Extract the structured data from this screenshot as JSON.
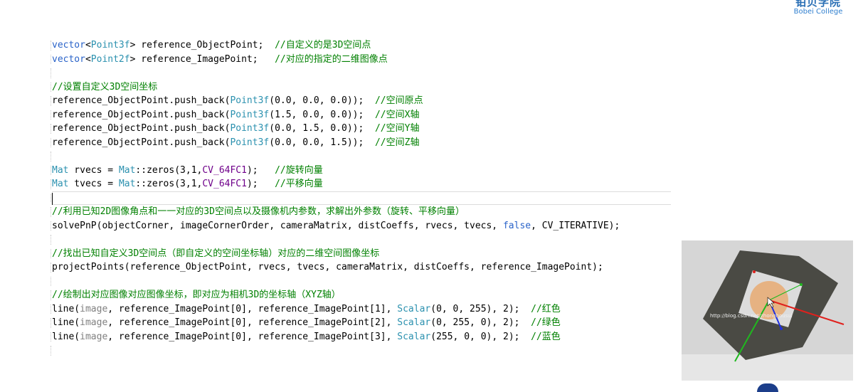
{
  "brand": {
    "name_cn": "铂贝学院",
    "name_en": "Bobei College"
  },
  "code_lines": [
    [
      {
        "t": "kw",
        "v": "vector"
      },
      {
        "t": "p",
        "v": "<"
      },
      {
        "t": "ty",
        "v": "Point3f"
      },
      {
        "t": "p",
        "v": "> reference_ObjectPoint;  "
      },
      {
        "t": "cm",
        "v": "//自定义的是3D空间点"
      }
    ],
    [
      {
        "t": "kw",
        "v": "vector"
      },
      {
        "t": "p",
        "v": "<"
      },
      {
        "t": "ty",
        "v": "Point2f"
      },
      {
        "t": "p",
        "v": "> reference_ImagePoint;   "
      },
      {
        "t": "cm",
        "v": "//对应的指定的二维图像点"
      }
    ],
    [],
    [
      {
        "t": "cm",
        "v": "//设置自定义3D空间坐标"
      }
    ],
    [
      {
        "t": "p",
        "v": "reference_ObjectPoint.push_back("
      },
      {
        "t": "ty",
        "v": "Point3f"
      },
      {
        "t": "p",
        "v": "(0.0, 0.0, 0.0));  "
      },
      {
        "t": "cm",
        "v": "//空间原点"
      }
    ],
    [
      {
        "t": "p",
        "v": "reference_ObjectPoint.push_back("
      },
      {
        "t": "ty",
        "v": "Point3f"
      },
      {
        "t": "p",
        "v": "(1.5, 0.0, 0.0));  "
      },
      {
        "t": "cm",
        "v": "//空间X轴"
      }
    ],
    [
      {
        "t": "p",
        "v": "reference_ObjectPoint.push_back("
      },
      {
        "t": "ty",
        "v": "Point3f"
      },
      {
        "t": "p",
        "v": "(0.0, 1.5, 0.0));  "
      },
      {
        "t": "cm",
        "v": "//空间Y轴"
      }
    ],
    [
      {
        "t": "p",
        "v": "reference_ObjectPoint.push_back("
      },
      {
        "t": "ty",
        "v": "Point3f"
      },
      {
        "t": "p",
        "v": "(0.0, 0.0, 1.5));  "
      },
      {
        "t": "cm",
        "v": "//空间Z轴"
      }
    ],
    [],
    [
      {
        "t": "ty",
        "v": "Mat"
      },
      {
        "t": "p",
        "v": " rvecs = "
      },
      {
        "t": "ty",
        "v": "Mat"
      },
      {
        "t": "p",
        "v": "::zeros(3,1,"
      },
      {
        "t": "mac",
        "v": "CV_64FC1"
      },
      {
        "t": "p",
        "v": ");   "
      },
      {
        "t": "cm",
        "v": "//旋转向量"
      }
    ],
    [
      {
        "t": "ty",
        "v": "Mat"
      },
      {
        "t": "p",
        "v": " tvecs = "
      },
      {
        "t": "ty",
        "v": "Mat"
      },
      {
        "t": "p",
        "v": "::zeros(3,1,"
      },
      {
        "t": "mac",
        "v": "CV_64FC1"
      },
      {
        "t": "p",
        "v": ");   "
      },
      {
        "t": "cm",
        "v": "//平移向量"
      }
    ],
    "CURSOR",
    [
      {
        "t": "cm",
        "v": "//利用已知2D图像角点和一一对应的3D空间点以及摄像机内参数，求解出外参数（旋转、平移向量）"
      }
    ],
    [
      {
        "t": "p",
        "v": "solvePnP(objectCorner, imageCornerOrder, cameraMatrix, distCoeffs, rvecs, tvecs, "
      },
      {
        "t": "kw",
        "v": "false"
      },
      {
        "t": "p",
        "v": ", CV_ITERATIVE);"
      }
    ],
    [],
    [
      {
        "t": "cm",
        "v": "//找出已知自定义3D空间点（即自定义的空间坐标轴）对应的二维空间图像坐标"
      }
    ],
    [
      {
        "t": "p",
        "v": "projectPoints(reference_ObjectPoint, rvecs, tvecs, cameraMatrix, distCoeffs, reference_ImagePoint);"
      }
    ],
    [],
    [
      {
        "t": "cm",
        "v": "//绘制出对应图像对应图像坐标，即对应为相机3D的坐标轴（XYZ轴）"
      }
    ],
    [
      {
        "t": "p",
        "v": "line("
      },
      {
        "t": "gray",
        "v": "image"
      },
      {
        "t": "p",
        "v": ", reference_ImagePoint[0], reference_ImagePoint[1], "
      },
      {
        "t": "ty",
        "v": "Scalar"
      },
      {
        "t": "p",
        "v": "(0, 0, 255), 2);  "
      },
      {
        "t": "cm",
        "v": "//红色"
      }
    ],
    [
      {
        "t": "p",
        "v": "line("
      },
      {
        "t": "gray",
        "v": "image"
      },
      {
        "t": "p",
        "v": ", reference_ImagePoint[0], reference_ImagePoint[2], "
      },
      {
        "t": "ty",
        "v": "Scalar"
      },
      {
        "t": "p",
        "v": "(0, 255, 0), 2);  "
      },
      {
        "t": "cm",
        "v": "//绿色"
      }
    ],
    [
      {
        "t": "p",
        "v": "line("
      },
      {
        "t": "gray",
        "v": "image"
      },
      {
        "t": "p",
        "v": ", reference_ImagePoint[0], reference_ImagePoint[3], "
      },
      {
        "t": "ty",
        "v": "Scalar"
      },
      {
        "t": "p",
        "v": "(255, 0, 0), 2);  "
      },
      {
        "t": "cm",
        "v": "//蓝色"
      }
    ],
    []
  ],
  "webcam": {
    "watermark": "http://blog.csdn.net/zhonghousui"
  },
  "colors": {
    "keyword": "#2a63c9",
    "type": "#2b91af",
    "macro": "#6f008a",
    "comment": "#008000",
    "brand": "#2a6fb5"
  }
}
